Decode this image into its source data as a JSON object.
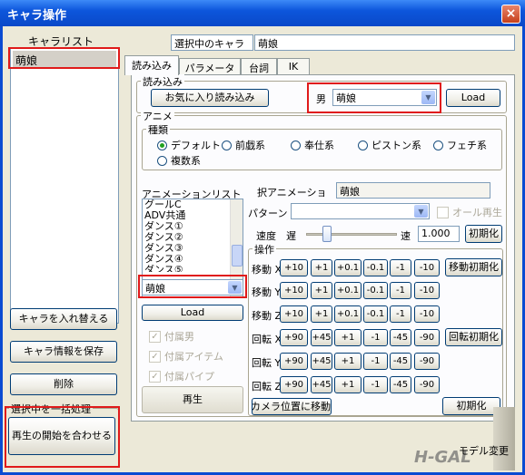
{
  "window": {
    "title": "キャラ操作",
    "close": "×"
  },
  "chara_list": {
    "header": "キャラリスト",
    "items": [
      "萌娘"
    ]
  },
  "left_buttons": {
    "swap": "キャラを入れ替える",
    "save_info": "キャラ情報を保存",
    "delete": "削除"
  },
  "batch": {
    "group_label": "選択中を一括処理",
    "sync_start": "再生の開始を合わせる"
  },
  "selected_chara": {
    "label": "選択中のキャラ",
    "value": "萌娘"
  },
  "tabs": [
    "読み込み",
    "パラメータ",
    "台詞",
    "IK"
  ],
  "load_group": {
    "label": "読み込み",
    "favorites": "お気に入り読み込み",
    "gender_label": "男",
    "gender_value": "萌娘",
    "load": "Load"
  },
  "anime": {
    "label": "アニメ",
    "kind_label": "種類",
    "kinds": [
      "デフォルト",
      "前戯系",
      "奉仕系",
      "ピストン系",
      "フェチ系",
      "複数系"
    ],
    "selected_kind": "デフォルト"
  },
  "anim_list": {
    "header": "アニメーションリスト",
    "items": [
      "グールC",
      "ADV共通",
      "ダンス①",
      "ダンス②",
      "ダンス③",
      "ダンス④",
      "ダンス⑤"
    ],
    "combo_value": "萌娘",
    "load": "Load"
  },
  "attach": {
    "male": "付属男",
    "item": "付属アイテム",
    "pipe": "付属パイプ"
  },
  "play": "再生",
  "sel_anim": {
    "label": "択アニメーショ",
    "value": "萌娘"
  },
  "pattern": {
    "label": "パターン",
    "value": ""
  },
  "all_play": "オール再生",
  "speed": {
    "label": "速度",
    "slow": "遅",
    "fast": "速",
    "value": "1.000",
    "init": "初期化"
  },
  "operate": {
    "label": "操作",
    "rows": [
      {
        "label": "移動 X",
        "btns": [
          "+10",
          "+1",
          "+0.1",
          "-0.1",
          "-1",
          "-10"
        ],
        "init": "移動初期化"
      },
      {
        "label": "移動 Y",
        "btns": [
          "+10",
          "+1",
          "+0.1",
          "-0.1",
          "-1",
          "-10"
        ],
        "init": ""
      },
      {
        "label": "移動 Z",
        "btns": [
          "+10",
          "+1",
          "+0.1",
          "-0.1",
          "-1",
          "-10"
        ],
        "init": ""
      },
      {
        "label": "回転 X",
        "btns": [
          "+90",
          "+45",
          "+1",
          "-1",
          "-45",
          "-90"
        ],
        "init": "回転初期化"
      },
      {
        "label": "回転 Y",
        "btns": [
          "+90",
          "+45",
          "+1",
          "-1",
          "-45",
          "-90"
        ],
        "init": ""
      },
      {
        "label": "回転 Z",
        "btns": [
          "+90",
          "+45",
          "+1",
          "-1",
          "-45",
          "-90"
        ],
        "init": ""
      }
    ],
    "camera": "カメラ位置に移動",
    "init": "初期化"
  },
  "watermark": "H-GAL",
  "footer_text": "モデル変更"
}
